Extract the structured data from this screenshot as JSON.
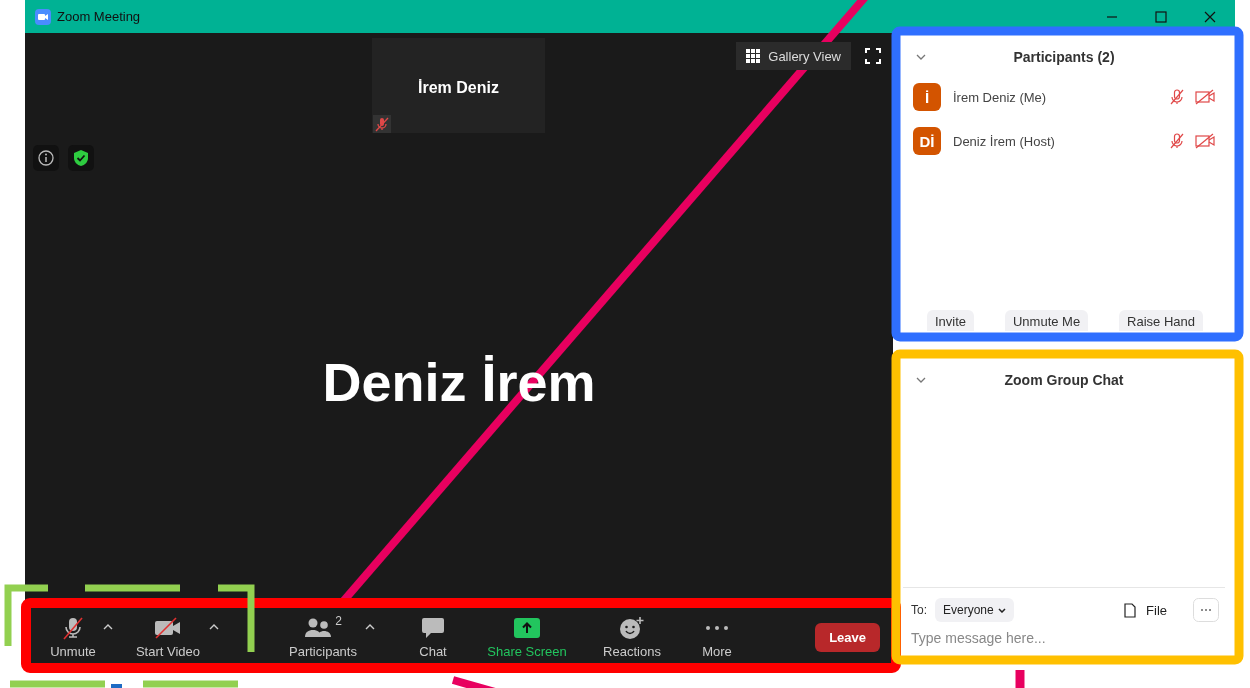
{
  "window": {
    "title": "Zoom Meeting"
  },
  "video": {
    "thumbnail": {
      "name": "İrem Deniz",
      "muted": true
    },
    "view_button": "Gallery View",
    "main_name": "Deniz İrem"
  },
  "toolbar": {
    "items": [
      {
        "kind": "mic",
        "label": "Unmute",
        "off": true,
        "caret": true
      },
      {
        "kind": "camera",
        "label": "Start Video",
        "off": true,
        "caret": true
      },
      {
        "kind": "participants",
        "label": "Participants",
        "count": "2",
        "caret": true
      },
      {
        "kind": "chat",
        "label": "Chat",
        "caret": false
      },
      {
        "kind": "share",
        "label": "Share Screen",
        "caret": false
      },
      {
        "kind": "reactions",
        "label": "Reactions",
        "caret": false
      },
      {
        "kind": "more",
        "label": "More",
        "caret": false
      }
    ],
    "leave": "Leave"
  },
  "participants": {
    "title": "Participants (2)",
    "items": [
      {
        "initials": "İ",
        "name": "İrem Deniz (Me)",
        "mic_muted": true,
        "video_off": true
      },
      {
        "initials": "Dİ",
        "name": "Deniz İrem (Host)",
        "mic_muted": true,
        "video_off": true
      }
    ],
    "buttons": [
      "Invite",
      "Unmute Me",
      "Raise Hand"
    ]
  },
  "chat": {
    "title": "Zoom Group Chat",
    "to_label": "To:",
    "recipient": "Everyone",
    "file": "File",
    "placeholder": "Type message here..."
  }
}
